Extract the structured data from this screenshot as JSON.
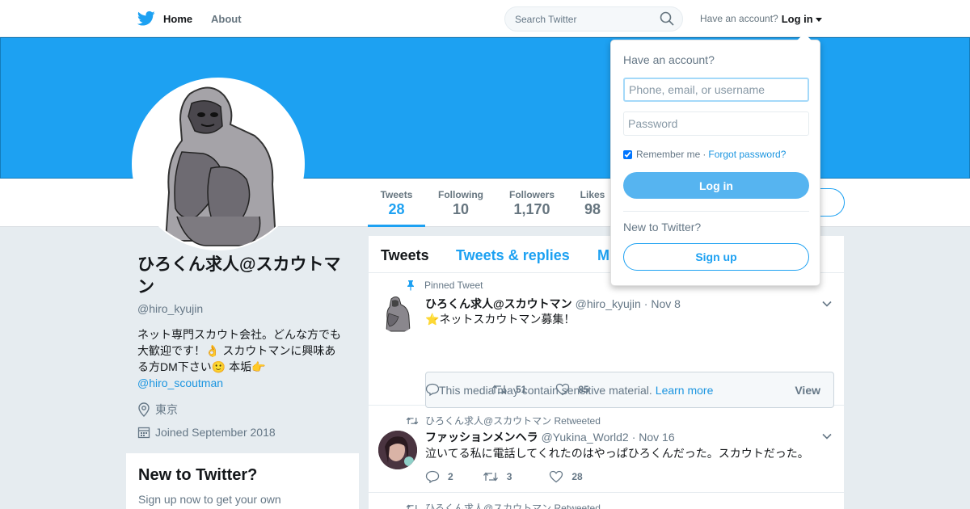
{
  "nav": {
    "home": "Home",
    "about": "About"
  },
  "search": {
    "placeholder": "Search Twitter"
  },
  "account": {
    "prompt": "Have an account?",
    "login": "Log in"
  },
  "profile": {
    "name": "ひろくん求人@スカウトマン",
    "handle": "@hiro_kyujin",
    "bio_line1": "ネット専門スカウト会社。どんな方でも",
    "bio_line2a": "大歓迎です！",
    "bio_emoji_ok": "👌",
    "bio_line2b": " スカウトマンに興味あ",
    "bio_line3a": "る方DM下さい",
    "bio_emoji_smile": "🙂",
    "bio_line3b": " 本垢",
    "bio_emoji_point": "👉",
    "bio_link": "@hiro_scoutman",
    "location": "東京",
    "joined": "Joined September 2018"
  },
  "stats": [
    {
      "label": "Tweets",
      "value": "28"
    },
    {
      "label": "Following",
      "value": "10"
    },
    {
      "label": "Followers",
      "value": "1,170"
    },
    {
      "label": "Likes",
      "value": "98"
    }
  ],
  "new_to_twitter": {
    "title": "New to Twitter?",
    "text": "Sign up now to get your own"
  },
  "timeline": {
    "tabs": [
      "Tweets",
      "Tweets & replies",
      "M"
    ],
    "tweets": [
      {
        "context": "Pinned Tweet",
        "name": "ひろくん求人@スカウトマン",
        "handle": "@hiro_kyujin",
        "date": "· Nov 8",
        "star": "⭐",
        "text": "ネットスカウトマン募集！",
        "sensitive_text": "This media may contain sensitive material.",
        "sensitive_link": "Learn more",
        "sensitive_view": "View",
        "replies": "",
        "retweets": "51",
        "likes": "85"
      },
      {
        "context": "ひろくん求人@スカウトマン Retweeted",
        "name": "ファッションメンヘラ",
        "handle": "@Yukina_World2",
        "date": "· Nov 16",
        "text": "泣いてる私に電話してくれたのはやっぱひろくんだった。スカウトだった。",
        "replies": "2",
        "retweets": "3",
        "likes": "28"
      },
      {
        "context": "ひろくん求人@スカウトマン Retweeted"
      }
    ]
  },
  "login_dropdown": {
    "title": "Have an account?",
    "username_placeholder": "Phone, email, or username",
    "password_placeholder": "Password",
    "remember": "Remember me",
    "separator": "·",
    "forgot": "Forgot password?",
    "login_button": "Log in",
    "new_prompt": "New to Twitter?",
    "signup_button": "Sign up"
  },
  "colors": {
    "brand": "#1da1f2",
    "link": "#1b95e0",
    "muted": "#657786"
  },
  "icons": [
    "twitter-bird-icon",
    "home-icon",
    "search-icon",
    "caret-down-icon",
    "location-icon",
    "calendar-icon",
    "pin-icon",
    "retweet-icon",
    "reply-icon",
    "like-icon",
    "chevron-down-icon"
  ]
}
